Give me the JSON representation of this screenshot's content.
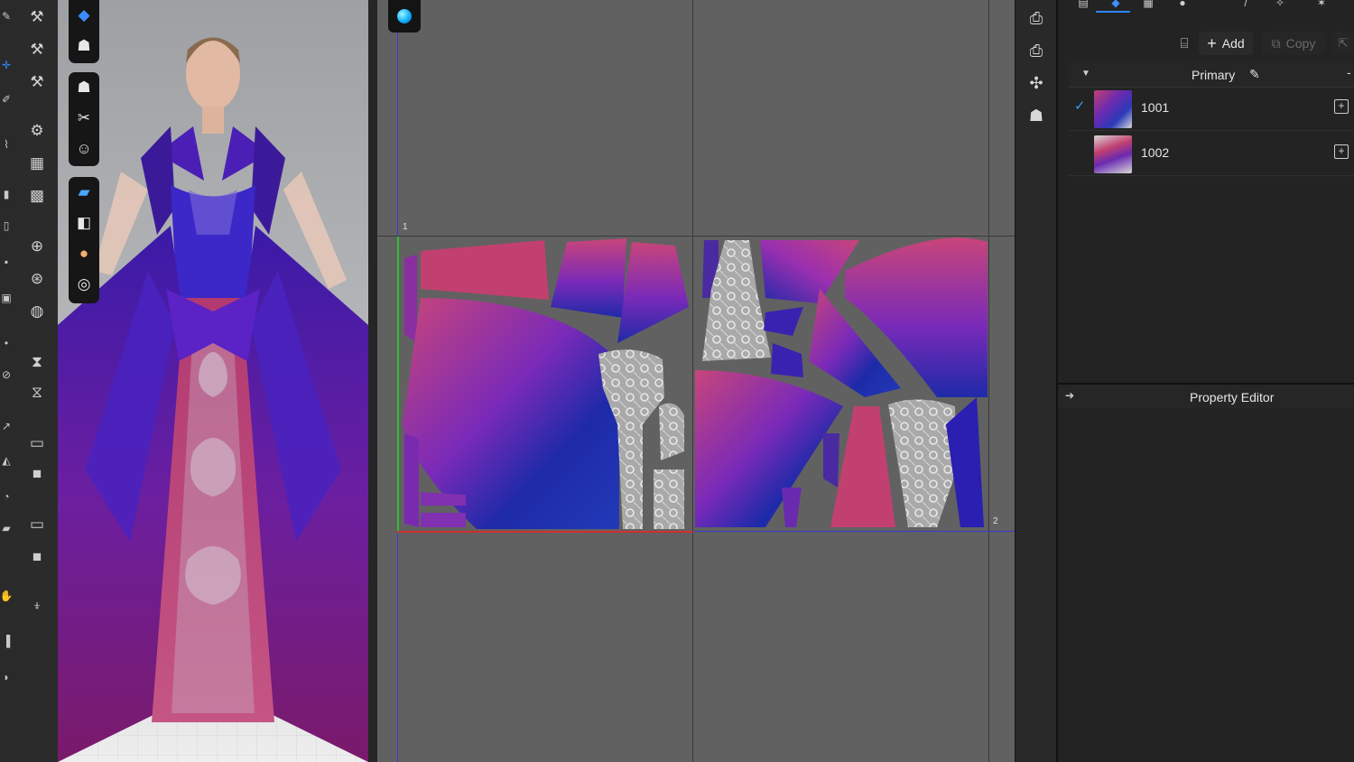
{
  "left_strip": {
    "icons": [
      "edit-icon",
      "move-icon",
      "pen-icon",
      "sewing-icon",
      "tuck-icon",
      "fold-icon",
      "pin-icon",
      "zip-icon",
      "puckering-icon",
      "lock-icon",
      "trim-icon",
      "tack-icon",
      "button-icon",
      "texture-icon",
      "hand-icon",
      "arrange-icon"
    ]
  },
  "tool_column": {
    "icons": [
      "simulate-icon",
      "fold-icon",
      "fold-arrangement-icon",
      "tuck-icon",
      "gather-icon",
      "knit-icon",
      "arrangement-point-icon",
      "button-icon",
      "buttonhole-icon",
      "zipper-icon",
      "puller-icon",
      "box-select-icon",
      "select-solid-icon",
      "uv-box-icon",
      "uv-solid-icon",
      "hand-pin-icon"
    ]
  },
  "viewport_tools": {
    "group1": [
      "cube-icon",
      "shirt-gray-icon"
    ],
    "group2": [
      "shirt-icon",
      "scissors-icon",
      "avatar-icon"
    ],
    "group3": [
      "texture-icon",
      "surface-icon",
      "skin-icon",
      "globe-icon"
    ]
  },
  "pattern_window": {
    "indicator": "sphere-icon",
    "tile_labels": [
      "1",
      "1",
      "2"
    ]
  },
  "right_strip": {
    "icons": [
      "camera-ar-icon",
      "camera-3d-icon",
      "transform-icon",
      "fold-pieces-icon"
    ]
  },
  "colorway_panel": {
    "top_tabs": [
      "library-icon",
      "object-icon",
      "colorway-icon",
      "sphere-tab-icon",
      "brush-icon",
      "sparkle-icon",
      "star-icon"
    ],
    "add_label": "Add",
    "copy_label": "Copy",
    "group_name": "Primary",
    "items": [
      {
        "label": "1001",
        "selected": true
      },
      {
        "label": "1002",
        "selected": false
      }
    ],
    "property_editor_title": "Property Editor"
  },
  "colors": {
    "accent": "#1e88e5",
    "pink": "#c2406f",
    "purple": "#5a1fa6",
    "blue": "#1d2e9c"
  }
}
